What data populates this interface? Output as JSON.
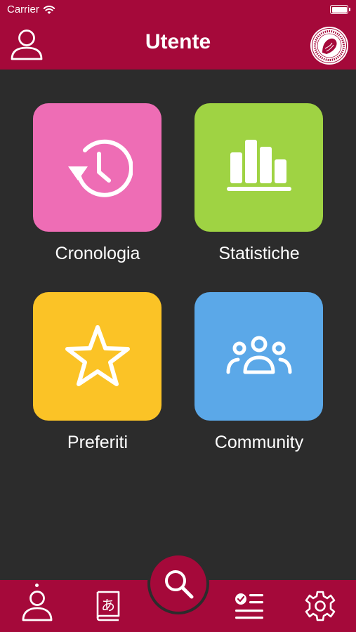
{
  "status_bar": {
    "carrier": "Carrier"
  },
  "header": {
    "title": "Utente"
  },
  "tiles": [
    {
      "label": "Cronologia",
      "color": "#ee6db5",
      "icon": "history-icon"
    },
    {
      "label": "Statistiche",
      "color": "#9fd343",
      "icon": "bar-chart-icon"
    },
    {
      "label": "Preferiti",
      "color": "#fbc326",
      "icon": "star-icon"
    },
    {
      "label": "Community",
      "color": "#5ba8e8",
      "icon": "community-icon"
    }
  ],
  "bottom_nav": {
    "items": [
      "profile-icon",
      "dictionary-icon",
      "search-icon",
      "checklist-icon",
      "settings-icon"
    ],
    "active": "profile-icon"
  },
  "colors": {
    "brand": "#a5093a",
    "background": "#2c2c2c"
  }
}
